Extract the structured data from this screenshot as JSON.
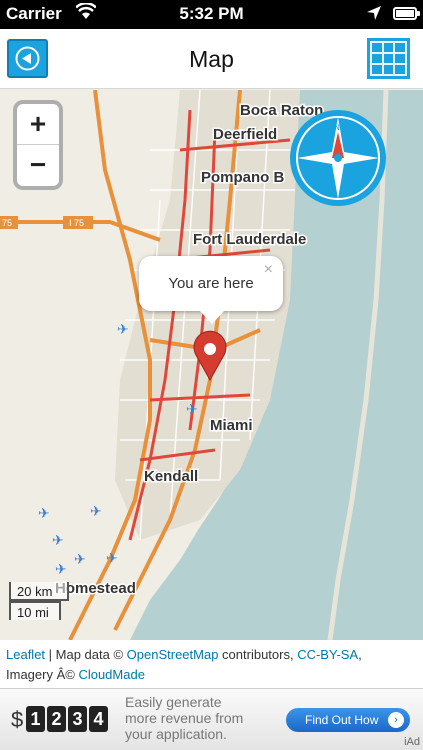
{
  "status_bar": {
    "carrier": "Carrier",
    "time": "5:32 PM",
    "wifi_icon": "wifi-icon",
    "location_icon": "location-arrow-icon",
    "battery_icon": "battery-icon"
  },
  "nav": {
    "title": "Map",
    "back_icon": "back-arrow-icon",
    "menu_icon": "grid-menu-icon"
  },
  "map": {
    "zoom_in_label": "+",
    "zoom_out_label": "−",
    "compass_icon": "compass-icon",
    "marker_icon": "map-pin-icon",
    "airport_icon": "airplane-icon",
    "highway_label": "I 75",
    "highway_label_left": "75",
    "cities": {
      "boca_raton": "Boca Raton",
      "deerfield": "Deerfield",
      "pompano": "Pompano B",
      "fort_lauderdale": "Fort Lauderdale",
      "miami": "Miami",
      "kendall": "Kendall",
      "homestead": "Homestead"
    },
    "popup": {
      "text": "You are here",
      "close": "×"
    },
    "scale": {
      "km": "20 km",
      "mi": "10 mi"
    },
    "colors": {
      "water": "#b5d0d0",
      "land": "#f0ede4",
      "highway": "#e8903a",
      "primary_road": "#e0473b",
      "accent": "#1aa3de"
    }
  },
  "attribution": {
    "leaflet": "Leaflet",
    "sep1": " | Map data © ",
    "osm": "OpenStreetMap",
    "contrib": " contributors, ",
    "license": "CC-BY-SA",
    "comma": ",",
    "imagery": "Imagery Â© ",
    "cloudmade": "CloudMade"
  },
  "ad": {
    "dollar": "$",
    "digits": [
      "1",
      "2",
      "3",
      "4"
    ],
    "line1": "Easily generate",
    "line2": "more revenue from",
    "line3": "your application.",
    "cta": "Find Out How",
    "cta_arrow": "›",
    "iad": "iAd"
  }
}
